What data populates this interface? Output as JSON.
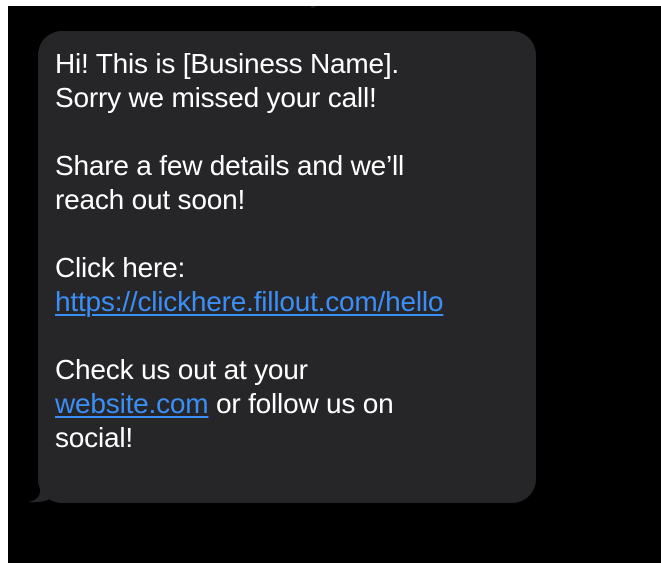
{
  "message": {
    "greeting_line1": "Hi! This is [Business Name].",
    "greeting_line2": "Sorry we missed your call!",
    "share_line1": "Share a few details and we’ll",
    "share_line2": "reach out soon!",
    "click_label": "Click here:",
    "link_url": "https://clickhere.fillout.com/hello",
    "check_line1": "Check us out at your",
    "website_link": "website.com",
    "follow_text": " or follow us on",
    "social_text": "social!"
  },
  "colors": {
    "background": "#000000",
    "bubble": "#262629",
    "text": "#ffffff",
    "link": "#3b8ef6"
  }
}
